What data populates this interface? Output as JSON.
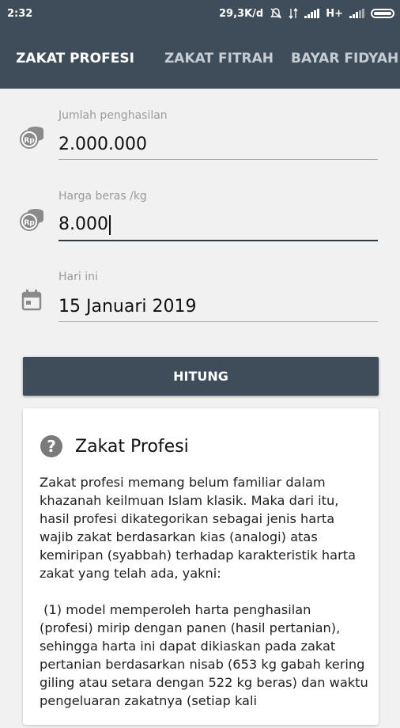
{
  "status_bar": {
    "time": "2:32",
    "speed": "29,3K/d",
    "network": "H+"
  },
  "tabs": [
    {
      "label": "ZAKAT PROFESI",
      "active": true
    },
    {
      "label": "ZAKAT FITRAH",
      "active": false
    },
    {
      "label": "BAYAR FIDYAH",
      "active": false
    }
  ],
  "form": {
    "income": {
      "label": "Jumlah penghasilan",
      "value": "2.000.000",
      "icon": "rupiah-coins-icon"
    },
    "rice_price": {
      "label": "Harga beras /kg",
      "value": "8.000",
      "icon": "rupiah-coins-icon"
    },
    "date": {
      "label": "Hari ini",
      "value": "15 Januari 2019",
      "icon": "calendar-icon"
    }
  },
  "button": {
    "hitung": "HITUNG"
  },
  "info_card": {
    "title": "Zakat Profesi",
    "icon": "help-icon",
    "paragraph1": "Zakat profesi memang belum familiar dalam khazanah keilmuan Islam klasik. Maka dari itu, hasil profesi dikategorikan sebagai jenis harta wajib zakat berdasarkan kias (analogi) atas kemiripan (syabbah) terhadap karakteristik harta zakat yang telah ada, yakni:",
    "paragraph2": " (1) model memperoleh harta penghasilan (profesi) mirip dengan panen (hasil pertanian), sehingga harta ini dapat dikiaskan pada zakat pertanian berdasarkan nisab (653 kg gabah kering giling atau setara dengan 522 kg beras) dan waktu pengeluaran zakatnya (setiap kali"
  },
  "colors": {
    "appbar": "#3f4d5a",
    "background": "#f1f1f1"
  }
}
